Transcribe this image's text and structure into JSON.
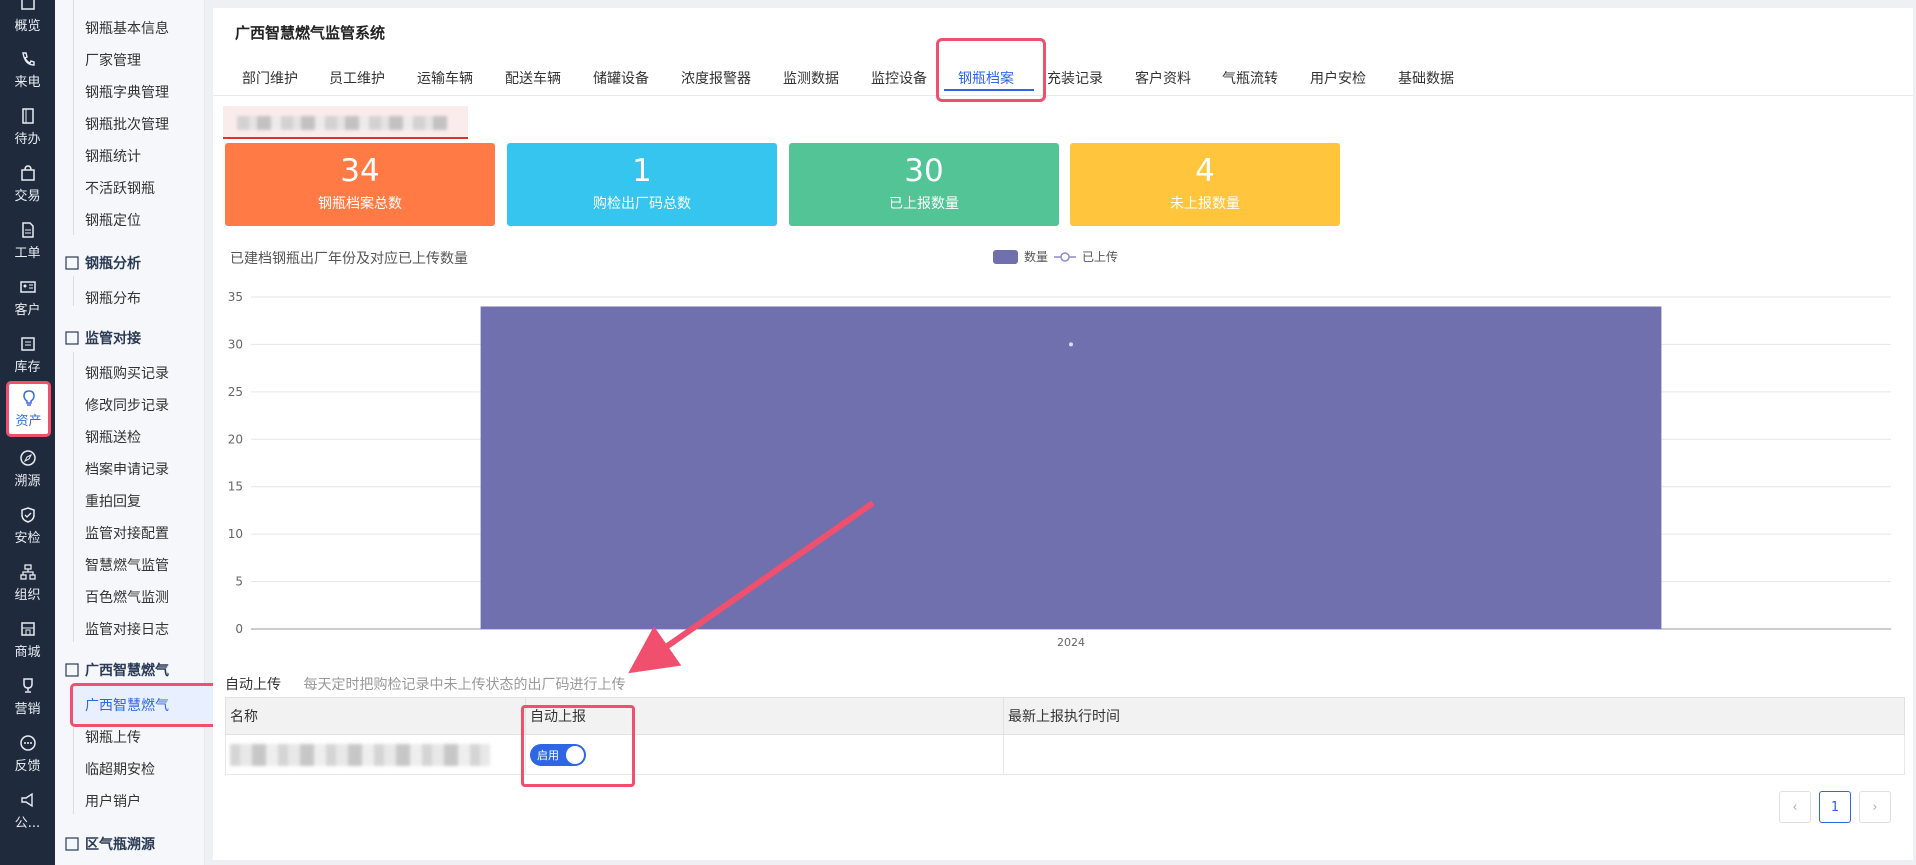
{
  "rail": {
    "items": [
      {
        "label": "概览",
        "icon": "overview-icon"
      },
      {
        "label": "来电",
        "icon": "phone-icon"
      },
      {
        "label": "待办",
        "icon": "todo-icon"
      },
      {
        "label": "交易",
        "icon": "bag-icon"
      },
      {
        "label": "工单",
        "icon": "ticket-icon"
      },
      {
        "label": "客户",
        "icon": "customer-card-icon"
      },
      {
        "label": "库存",
        "icon": "inventory-icon"
      },
      {
        "label": "资产",
        "icon": "bulb-icon"
      },
      {
        "label": "溯源",
        "icon": "compass-icon"
      },
      {
        "label": "安检",
        "icon": "shield-icon"
      },
      {
        "label": "组织",
        "icon": "org-icon"
      },
      {
        "label": "商城",
        "icon": "store-icon"
      },
      {
        "label": "营销",
        "icon": "trophy-icon"
      },
      {
        "label": "反馈",
        "icon": "chat-icon"
      },
      {
        "label": "公...",
        "icon": "megaphone-icon"
      }
    ],
    "active_index": 7
  },
  "submenu": {
    "items_top": [
      "钢瓶基本信息",
      "厂家管理",
      "钢瓶字典管理",
      "钢瓶批次管理",
      "钢瓶统计",
      "不活跃钢瓶",
      "钢瓶定位"
    ],
    "group_analysis": "钢瓶分析",
    "items_analysis": [
      "钢瓶分布"
    ],
    "group_supervision": "监管对接",
    "items_supervision": [
      "钢瓶购买记录",
      "修改同步记录",
      "钢瓶送检",
      "档案申请记录",
      "重拍回复",
      "监管对接配置",
      "智慧燃气监管",
      "百色燃气监测",
      "监管对接日志"
    ],
    "group_guangxi": "广西智慧燃气",
    "items_guangxi": [
      "广西智慧燃气",
      "钢瓶上传",
      "临超期安检",
      "用户销户"
    ],
    "group_district": "区气瓶溯源"
  },
  "header": {
    "system_title": "广西智慧燃气监管系统",
    "tabs": [
      "部门维护",
      "员工维护",
      "运输车辆",
      "配送车辆",
      "储罐设备",
      "浓度报警器",
      "监测数据",
      "监控设备",
      "钢瓶档案",
      "充装记录",
      "客户资料",
      "气瓶流转",
      "用户安检",
      "基础数据"
    ],
    "active_tab": 8
  },
  "stats": [
    {
      "value": "34",
      "label": "钢瓶档案总数",
      "color": "#ff7a45"
    },
    {
      "value": "1",
      "label": "购检出厂码总数",
      "color": "#36c5ee"
    },
    {
      "value": "30",
      "label": "已上报数量",
      "color": "#52c495"
    },
    {
      "value": "4",
      "label": "未上报数量",
      "color": "#ffc53d"
    }
  ],
  "chart_data": {
    "type": "bar",
    "title": "已建档钢瓶出厂年份及对应已上传数量",
    "categories": [
      "2024"
    ],
    "series": [
      {
        "name": "数量",
        "type": "bar",
        "values": [
          34
        ],
        "color": "#7070ae"
      },
      {
        "name": "已上传",
        "type": "line",
        "values": [
          30
        ],
        "color": "#8c8cc8"
      }
    ],
    "ylim": [
      0,
      35
    ],
    "yticks": [
      0,
      5,
      10,
      15,
      20,
      25,
      30,
      35
    ],
    "grid": true,
    "legend_position": "top-center"
  },
  "auto_upload": {
    "label": "自动上传",
    "hint": "每天定时把购检记录中未上传状态的出厂码进行上传"
  },
  "table": {
    "columns": [
      "名称",
      "自动上报",
      "最新上报执行时间"
    ],
    "rows": [
      {
        "toggle_label": "启用",
        "enabled": true,
        "last_time": ""
      }
    ]
  },
  "pagination": {
    "prev": "‹",
    "current": "1",
    "next": "›"
  }
}
